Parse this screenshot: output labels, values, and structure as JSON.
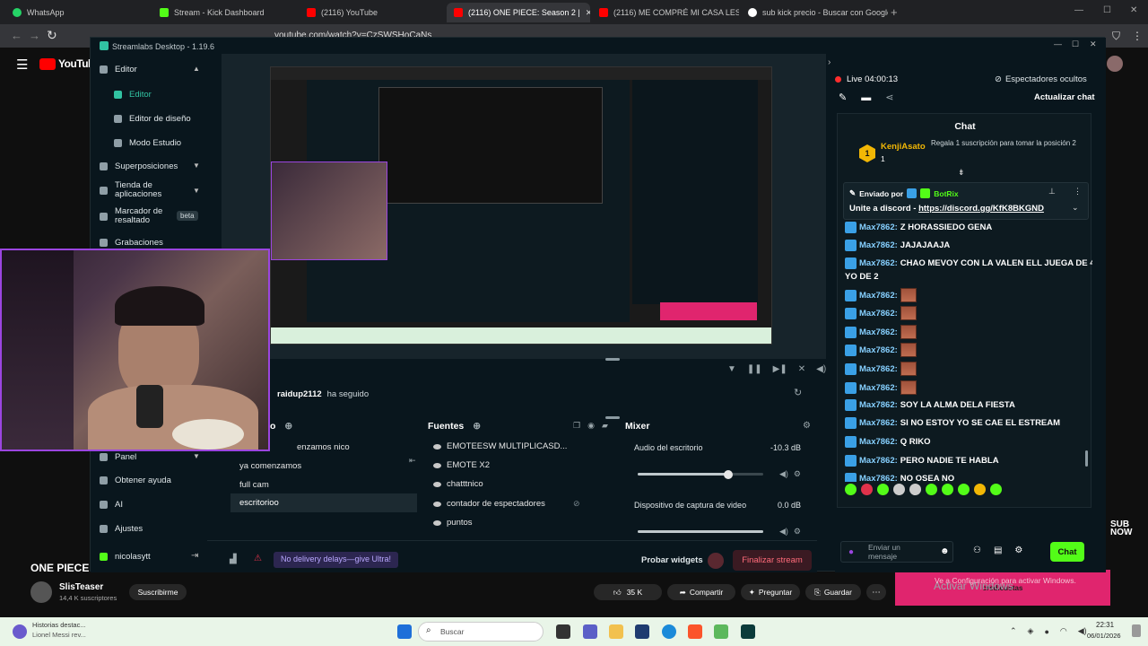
{
  "browser": {
    "tabs": [
      {
        "label": "WhatsApp",
        "color": "#25d366"
      },
      {
        "label": "Stream - Kick Dashboard",
        "color": "#53fc18"
      },
      {
        "label": "(2116) YouTube",
        "color": "#ff0000"
      },
      {
        "label": "(2116) ONE PIECE: Season 2 |",
        "color": "#ff0000"
      },
      {
        "label": "(2116) ME COMPRÉ MI CASA LES M...",
        "color": "#ff0000"
      },
      {
        "label": "sub kick precio - Buscar con Google",
        "color": "#ffffff"
      }
    ],
    "url": "youtube.com/watch?v=CzSWSHoCaNs"
  },
  "youtube": {
    "logo": "YouTube",
    "video_title_partial": "ONE PIECE: S",
    "channel_name": "SlisTeaser",
    "subscribers": "14,4 K suscriptores",
    "subscribe_label": "Suscribirme",
    "likes": "35 K",
    "share_label": "Compartir",
    "ask_label": "Preguntar",
    "save_label": "Guardar",
    "sub_now": "SUB NOW"
  },
  "streamlabs": {
    "title": "Streamlabs Desktop - 1.19.6",
    "sidebar": {
      "editor_group": "Editor",
      "editor": "Editor",
      "layout_editor": "Editor de diseño",
      "studio_mode": "Modo Estudio",
      "overlays": "Superposiciones",
      "app_store": "Tienda de aplicaciones",
      "highlighter": "Marcador de resaltado",
      "highlighter_badge": "beta",
      "recordings": "Grabaciones",
      "panel": "Panel",
      "help": "Obtener ayuda",
      "ai": "AI",
      "settings": "Ajustes",
      "user": "nicolasytt"
    },
    "event": {
      "user": "raidup2112",
      "action": "ha seguido"
    },
    "scenes": {
      "header_partial": "o",
      "items": [
        "enzamos nico",
        "ya comenzamos",
        "full cam",
        "escritorioo"
      ],
      "selected": "escritorioo"
    },
    "sources": {
      "header": "Fuentes",
      "items": [
        "EMOTEESW MULTIPLICASD...",
        "EMOTE X2",
        "chatttnico",
        "contador de espectadores",
        "puntos"
      ]
    },
    "mixer": {
      "header": "Mixer",
      "channels": [
        {
          "name": "Audio del escritorio",
          "level": "-10.3 dB",
          "fill": 0.72
        },
        {
          "name": "Dispositivo de captura de video",
          "level": "0.0 dB",
          "fill": 1.0
        }
      ]
    },
    "footer": {
      "promo": "No delivery delays—give Ultra!",
      "test_widgets": "Probar widgets",
      "end_stream": "Finalizar stream"
    },
    "live": {
      "status": "Live",
      "time": "04:00:13",
      "hidden_viewers": "Espectadores ocultos",
      "refresh_chat": "Actualizar chat"
    },
    "chat": {
      "header": "Chat",
      "gift_user": "KenjiAsato",
      "gift_count": "1",
      "gift_text": "Regala 1 suscripción para tomar la posición 2",
      "pinned_by_label": "Enviado por",
      "pinned_by_user": "BotRix",
      "pinned_text": "Unite a discord - ",
      "pinned_link": "https://discord.gg/KfK8BKGND",
      "messages": [
        {
          "user": "Max7862:",
          "text": "Z HORASSIEDO GENA",
          "emote": false
        },
        {
          "user": "Max7862:",
          "text": "JAJAJAAJA",
          "emote": false
        },
        {
          "user": "Max7862:",
          "text": "CHAO MEVOY CON LA VALEN ELL JUEGA DE 4 I",
          "emote": false
        },
        {
          "user": "",
          "text": "YO DE 2",
          "emote": false
        },
        {
          "user": "Max7862:",
          "text": "",
          "emote": true
        },
        {
          "user": "Max7862:",
          "text": "",
          "emote": true
        },
        {
          "user": "Max7862:",
          "text": "",
          "emote": true
        },
        {
          "user": "Max7862:",
          "text": "",
          "emote": true
        },
        {
          "user": "Max7862:",
          "text": "",
          "emote": true
        },
        {
          "user": "Max7862:",
          "text": "",
          "emote": true
        },
        {
          "user": "Max7862:",
          "text": "SOY LA ALMA DELA FIESTA",
          "emote": false
        },
        {
          "user": "Max7862:",
          "text": "SI NO ESTOY YO SE CAE EL ESTREAM",
          "emote": false
        },
        {
          "user": "Max7862:",
          "text": "Q RIKO",
          "emote": false
        },
        {
          "user": "Max7862:",
          "text": "PERO NADIE TE HABLA",
          "emote": false
        },
        {
          "user": "Max7862:",
          "text": "NO OSEA NO",
          "emote": false
        }
      ],
      "input_placeholder": "Enviar un mensaje",
      "send_label": "Chat"
    }
  },
  "windows": {
    "activate_title": "Activar Windows",
    "activate_sub": "Ve a Configuración para activar Windows.",
    "overlay_text": "credicuotas",
    "news_title": "Historias destac...",
    "news_sub": "Lionel Messi rev...",
    "search_placeholder": "Buscar",
    "time": "22:31",
    "date": "06/01/2026"
  },
  "colors": {
    "kick_green": "#53fc18",
    "end_stream_red": "#e0324b",
    "live_red": "#ff2d2d",
    "webcam_border": "#9b45e0"
  }
}
